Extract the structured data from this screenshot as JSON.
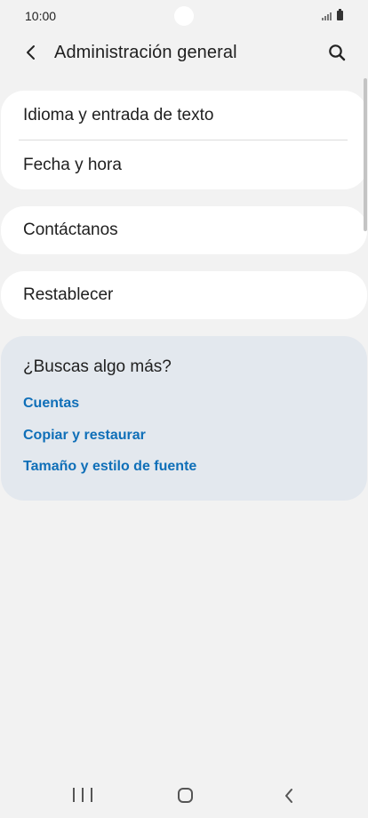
{
  "status_bar": {
    "time": "10:00"
  },
  "app_bar": {
    "title": "Administración general"
  },
  "settings": {
    "group_1": [
      {
        "label": "Idioma y entrada de texto"
      },
      {
        "label": "Fecha y hora"
      }
    ],
    "group_2": {
      "label": "Contáctanos"
    },
    "group_3": {
      "label": "Restablecer"
    }
  },
  "suggestions": {
    "title": "¿Buscas algo más?",
    "links": [
      {
        "label": "Cuentas"
      },
      {
        "label": "Copiar y restaurar"
      },
      {
        "label": "Tamaño y estilo de fuente"
      }
    ]
  },
  "icons": {
    "back": "back-arrow-icon",
    "search": "search-icon",
    "signal": "signal-icon",
    "battery": "battery-icon",
    "nav_recents": "recents-icon",
    "nav_home": "home-icon",
    "nav_back": "nav-back-icon"
  },
  "colors": {
    "background": "#f2f2f2",
    "card": "#ffffff",
    "suggest_card": "#e3e8ee",
    "link": "#0f6fb8"
  }
}
